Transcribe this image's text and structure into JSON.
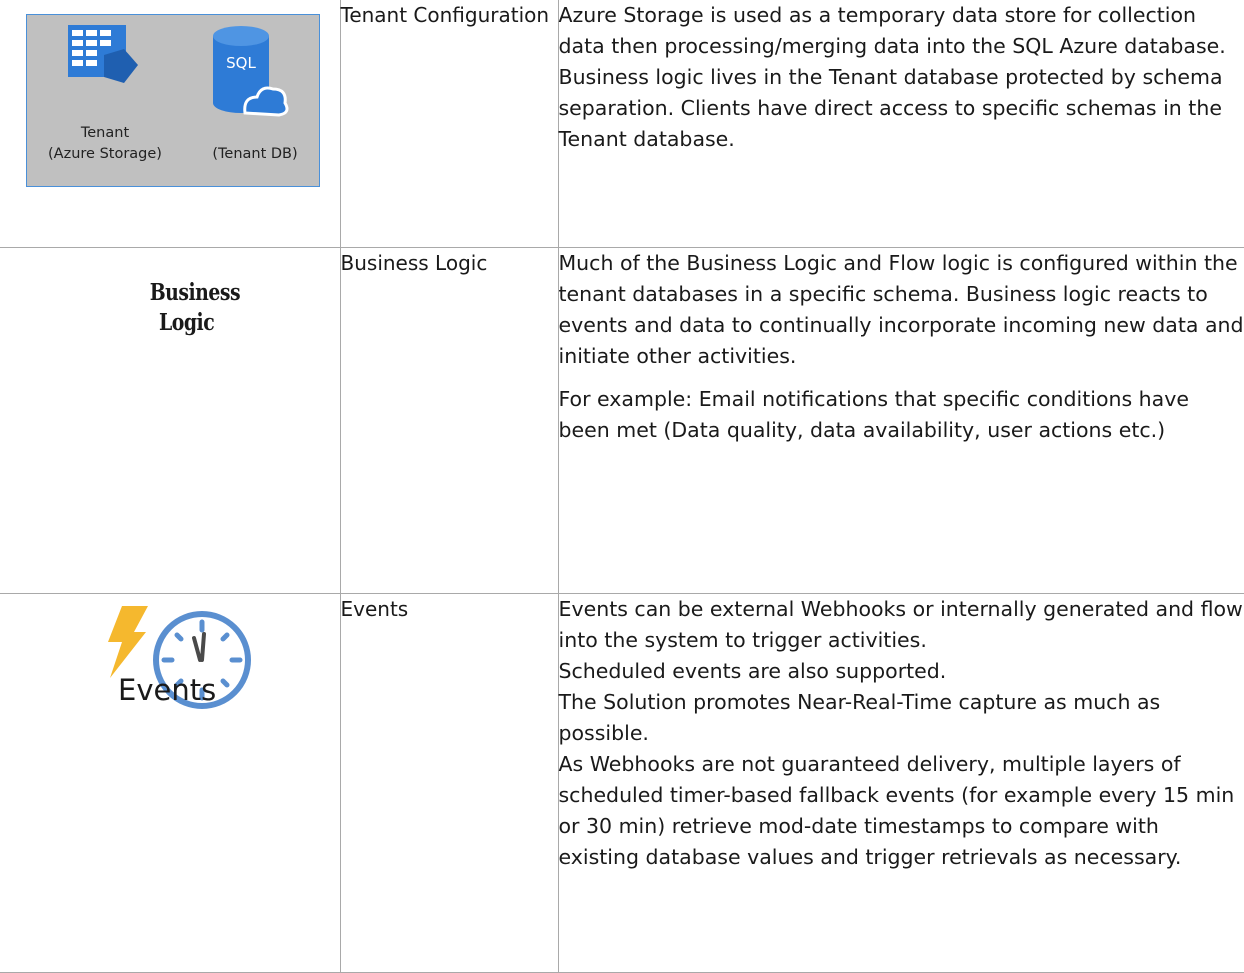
{
  "rows": [
    {
      "icon_labels": [
        "Tenant",
        "(Azure Storage)",
        "(Tenant DB)"
      ],
      "icon_texts": [
        "SQL"
      ],
      "name": "Tenant Configuration",
      "paragraphs": [
        "Azure Storage is used as a temporary data store for collection data then processing/merging data into the SQL Azure database. Business logic lives in the Tenant database protected by schema separation. Clients have direct access to specific schemas in the Tenant database."
      ]
    },
    {
      "icon_title": "Business Logic",
      "name": "Business Logic",
      "paragraphs": [
        "Much of the Business Logic and Flow logic is configured within the tenant databases in a specific schema. Business logic reacts to events and data to continually incorporate incoming new data and initiate other activities.",
        "For example: Email notifications that specific conditions have been met (Data quality, data availability, user actions etc.)"
      ]
    },
    {
      "icon_label": "Events",
      "name": "Events",
      "lines": [
        "Events can be external Webhooks or internally generated and flow into the system to trigger activities.",
        "Scheduled events are also supported.",
        "The Solution promotes Near-Real-Time capture as much as possible.",
        "As Webhooks are not guaranteed delivery, multiple layers of scheduled timer-based fallback events (for example every 15 min or 30 min) retrieve mod-date timestamps to compare with existing database values and trigger retrievals as necessary."
      ]
    }
  ],
  "colors": {
    "azure_blue": "#2e7bd6",
    "icon_panel_bg": "#c0c0c0",
    "icon_panel_border": "#4a90d9",
    "lightning": "#f5b82e",
    "clock": "#5a8fd0",
    "grid_border": "#a9a9a9"
  },
  "icons": [
    "storage-table-icon",
    "sql-database-icon",
    "lightning-icon",
    "clock-icon"
  ]
}
